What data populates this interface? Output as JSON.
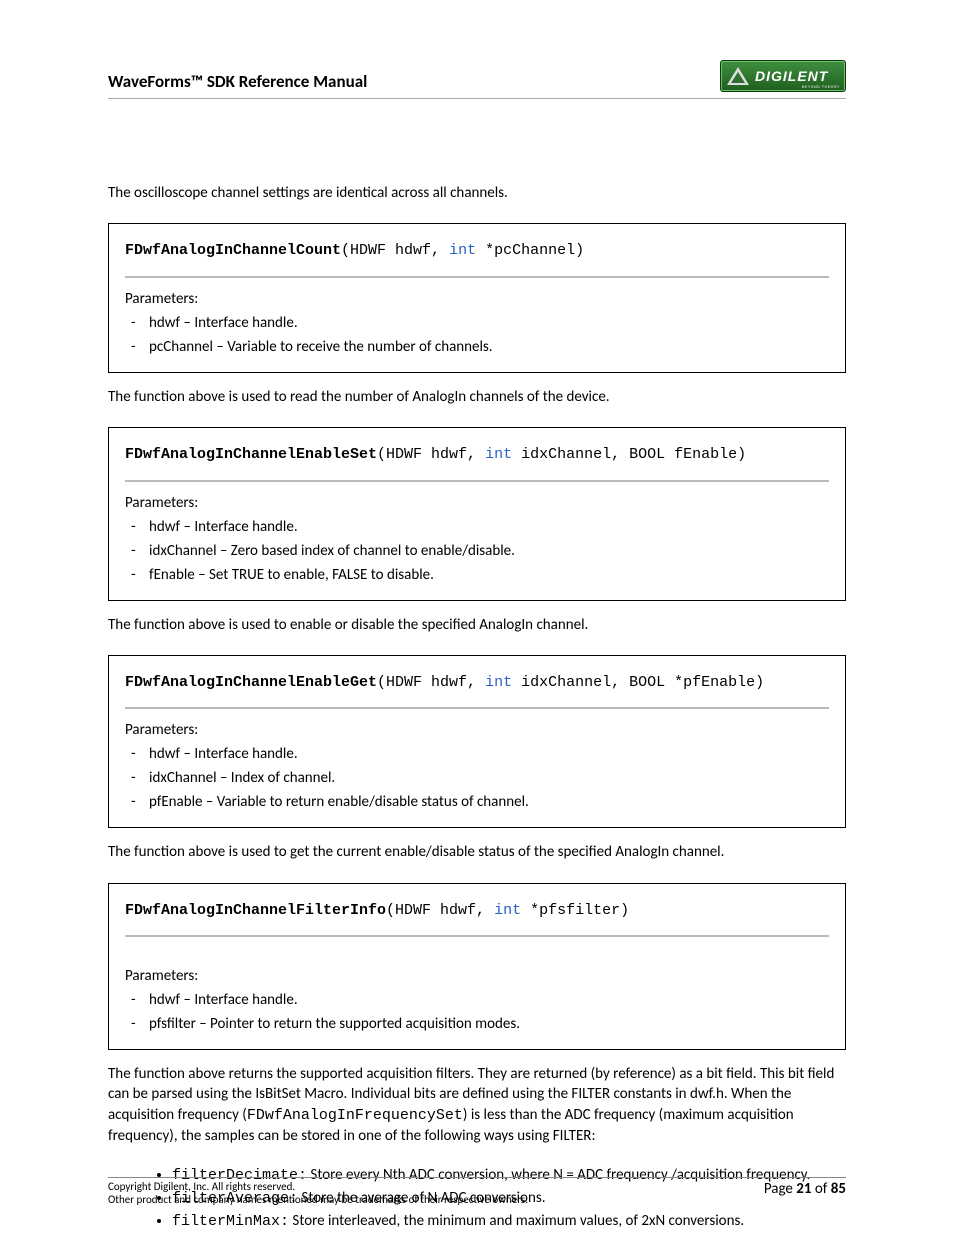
{
  "header": {
    "title": "WaveForms™ SDK Reference Manual",
    "logo_text": "DIGILENT",
    "logo_sub": "BEYOND THEORY"
  },
  "intro": "The oscilloscope channel settings are identical across all channels.",
  "functions": [
    {
      "name": "FDwfAnalogInChannelCount",
      "sig_rest": "(HDWF hdwf, ",
      "kw": "int",
      "sig_tail": " *pcChannel)",
      "params_label": "Parameters:",
      "params": [
        "hdwf – Interface handle.",
        "pcChannel – Variable to receive the number of channels."
      ],
      "desc": "The function above is used to read the number of AnalogIn channels of the device."
    },
    {
      "name": "FDwfAnalogInChannelEnableSet",
      "sig_rest": "(HDWF hdwf, ",
      "kw": "int",
      "sig_tail": " idxChannel, BOOL fEnable)",
      "params_label": "Parameters:",
      "params": [
        "hdwf – Interface handle.",
        "idxChannel – Zero based index of channel to enable/disable.",
        "fEnable – Set TRUE to enable, FALSE to disable."
      ],
      "desc": "The function above is used to enable or disable the specified AnalogIn channel."
    },
    {
      "name": "FDwfAnalogInChannelEnableGet",
      "sig_rest": "(HDWF hdwf, ",
      "kw": "int",
      "sig_tail": " idxChannel, BOOL *pfEnable)",
      "params_label": "Parameters:",
      "params": [
        "hdwf – Interface handle.",
        "idxChannel – Index of channel.",
        "pfEnable – Variable to return enable/disable status of channel."
      ],
      "desc": "The function above is used to get the current enable/disable status of the specified AnalogIn channel."
    },
    {
      "name": "FDwfAnalogInChannelFilterInfo",
      "sig_rest": "(HDWF hdwf, ",
      "kw": "int",
      "sig_tail": " *pfsfilter)",
      "extra_gap": true,
      "params_label": "Parameters:",
      "params": [
        "hdwf – Interface handle.",
        "pfsfilter – Pointer to return the supported acquisition modes."
      ],
      "desc": ""
    }
  ],
  "filter_para": {
    "p1": "The function above returns the supported acquisition filters. They are returned (by reference) as a bit field. This bit field can be parsed using the IsBitSet Macro. Individual bits are defined using the FILTER constants in dwf.h. When the acquisition frequency (",
    "code": "FDwfAnalogInFrequencySet",
    "p2": ") is less than the ADC frequency (maximum acquisition frequency), the samples can be stored in one of the following ways using FILTER:"
  },
  "filters": [
    {
      "code": "filterDecimate:",
      "text": "  Store every Nth ADC conversion, where N = ADC frequency /acquisition frequency."
    },
    {
      "code": "filterAverage:",
      "text": "  Store the average of N ADC conversions."
    },
    {
      "code": "filterMinMax:",
      "text": "  Store interleaved, the minimum and maximum values, of 2xN conversions."
    }
  ],
  "footer": {
    "left1": "Copyright Digilent, Inc. All rights reserved.",
    "left2": "Other product and company names mentioned may be trademarks of their respective owners.",
    "page_prefix": "Page ",
    "page_current": "21",
    "page_mid": " of ",
    "page_total": "85"
  }
}
